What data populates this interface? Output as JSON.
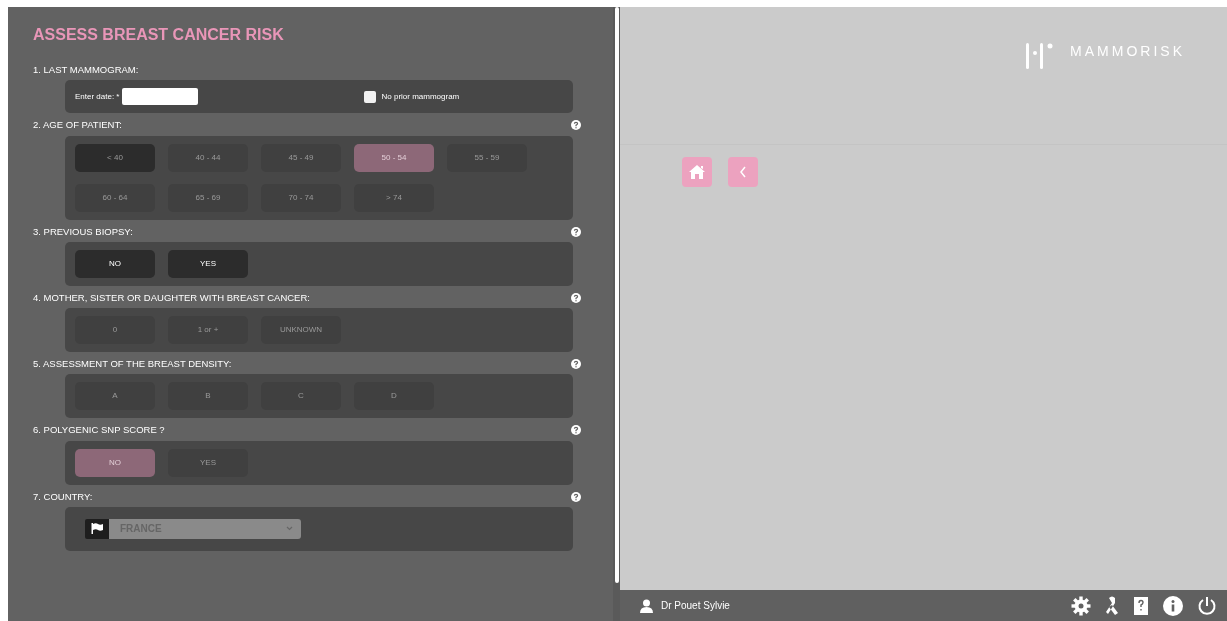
{
  "title": "ASSESS BREAST CANCER RISK",
  "sections": [
    {
      "kind": "date",
      "label": "1. LAST MAMMOGRAM:",
      "help": false,
      "date_label": "Enter date: *",
      "checkbox": {
        "label": "No prior mammogram",
        "checked": false
      }
    },
    {
      "kind": "options",
      "label": "2. AGE OF PATIENT:",
      "help": true,
      "options": [
        {
          "label": "< 40",
          "selected": false,
          "emphasis": true,
          "disabled": true
        },
        {
          "label": "40 - 44",
          "selected": false,
          "emphasis": false,
          "disabled": true
        },
        {
          "label": "45 - 49",
          "selected": false,
          "emphasis": false,
          "disabled": true
        },
        {
          "label": "50 - 54",
          "selected": true,
          "emphasis": false,
          "disabled": true
        },
        {
          "label": "55 - 59",
          "selected": false,
          "emphasis": false,
          "disabled": true
        },
        {
          "label": "60 - 64",
          "selected": false,
          "emphasis": false,
          "disabled": true
        },
        {
          "label": "65 - 69",
          "selected": false,
          "emphasis": false,
          "disabled": true
        },
        {
          "label": "70 - 74",
          "selected": false,
          "emphasis": false,
          "disabled": true
        },
        {
          "label": "> 74",
          "selected": false,
          "emphasis": false,
          "disabled": true
        }
      ]
    },
    {
      "kind": "options",
      "label": "3. PREVIOUS BIOPSY:",
      "help": true,
      "options": [
        {
          "label": "NO",
          "selected": false,
          "emphasis": true,
          "disabled": false
        },
        {
          "label": "YES",
          "selected": false,
          "emphasis": true,
          "disabled": false
        }
      ]
    },
    {
      "kind": "options",
      "label": "4. MOTHER, SISTER OR DAUGHTER WITH BREAST CANCER:",
      "help": true,
      "options": [
        {
          "label": "0",
          "selected": false,
          "emphasis": false,
          "disabled": true
        },
        {
          "label": "1 or +",
          "selected": false,
          "emphasis": false,
          "disabled": true
        },
        {
          "label": "UNKNOWN",
          "selected": false,
          "emphasis": false,
          "disabled": true
        }
      ]
    },
    {
      "kind": "options",
      "label": "5. ASSESSMENT OF THE BREAST DENSITY:",
      "help": true,
      "options": [
        {
          "label": "A",
          "selected": false,
          "emphasis": false,
          "disabled": true
        },
        {
          "label": "B",
          "selected": false,
          "emphasis": false,
          "disabled": true
        },
        {
          "label": "C",
          "selected": false,
          "emphasis": false,
          "disabled": true
        },
        {
          "label": "D",
          "selected": false,
          "emphasis": false,
          "disabled": true
        }
      ]
    },
    {
      "kind": "options",
      "label": "6. POLYGENIC SNP SCORE ?",
      "help": true,
      "options": [
        {
          "label": "NO",
          "selected": true,
          "emphasis": false,
          "disabled": true
        },
        {
          "label": "YES",
          "selected": false,
          "emphasis": false,
          "disabled": true
        }
      ]
    },
    {
      "kind": "select",
      "label": "7. COUNTRY:",
      "help": true,
      "value": "FRANCE"
    }
  ],
  "brand": "MAMMORISK",
  "user": "Dr Pouet Sylvie"
}
